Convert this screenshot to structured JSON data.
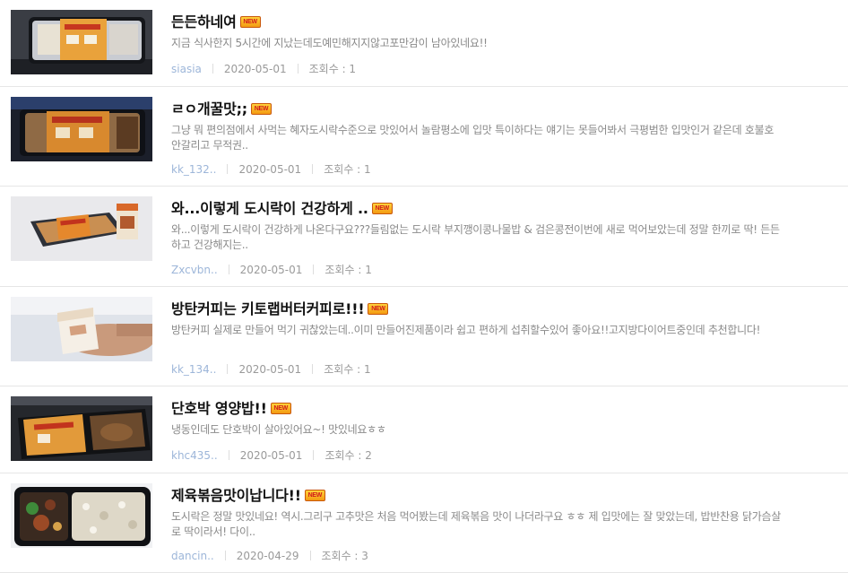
{
  "new_badge_label": "NEW",
  "posts": [
    {
      "title": "든든하네여",
      "description": "지금 식사한지 5시간에 지났는데도예민해지지않고포만감이 남아있네요!!",
      "author": "siasia",
      "date": "2020-05-01",
      "views": "조회수 : 1",
      "thumbnail": "meal-box-orange-label"
    },
    {
      "title": "ㄹㅇ개꿀맛;;",
      "description": "그냥 뭐 편의점에서 사먹는 혜자도시락수준으로 맛있어서 놀람평소에 입맛 특이하다는 얘기는 못들어봐서 극평범한 입맛인거 같은데 호불호 안갈리고 무적권..",
      "author": "kk_132..",
      "date": "2020-05-01",
      "views": "조회수 : 1",
      "thumbnail": "meal-box-dark"
    },
    {
      "title": "와...이렇게 도시락이 건강하게 ..",
      "description": "와...이렇게 도시락이 건강하게 나온다구요???들림없는 도시락 부지깽이콩나물밥 & 검은콩전이번에 새로 먹어보았는데 정말 한끼로 딱! 든든하고 건강해지는..",
      "author": "Zxcvbn..",
      "date": "2020-05-01",
      "views": "조회수 : 1",
      "thumbnail": "meal-box-with-drink"
    },
    {
      "title": "방탄커피는 키토랩버터커피로!!!",
      "description": "방탄커피 실제로 만들어 먹기 귀찮았는데..이미 만들어진제품이라 쉽고 편하게 섭취할수있어 좋아요!!고지방다이어트중인데 추천합니다!",
      "author": "kk_134..",
      "date": "2020-05-01",
      "views": "조회수 : 1",
      "thumbnail": "coffee-carton-in-hand"
    },
    {
      "title": "단호박 영양밥!!",
      "description": "냉동인데도 단호박이 살아있어요~! 맛있네요ㅎㅎ",
      "author": "khc435..",
      "date": "2020-05-01",
      "views": "조회수 : 2",
      "thumbnail": "pumpkin-rice-box"
    },
    {
      "title": "제육볶음맛이납니다!!",
      "description": "도시락은 정말 맛있네요! 역시.그리구 고추맛은 처음 먹어봤는데 제육볶음 맛이 나더라구요 ㅎㅎ 제 입맛에는 잘 맞았는데, 밥반찬용 닭가슴살로 딱이라서! 다이..",
      "author": "dancin..",
      "date": "2020-04-29",
      "views": "조회수 : 3",
      "thumbnail": "open-meal-box-rice"
    }
  ]
}
